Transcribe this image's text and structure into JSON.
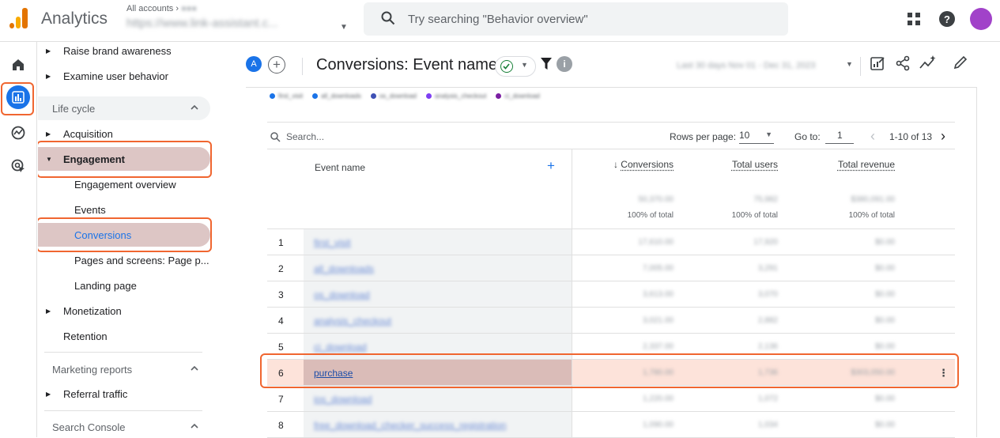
{
  "app": {
    "title": "Analytics"
  },
  "account": {
    "label": "All accounts",
    "name": "https://www.link-assistant.c..."
  },
  "search": {
    "placeholder": "Try searching \"Behavior overview\""
  },
  "nav": {
    "top_items": [
      "Raise brand awareness",
      "Examine user behavior"
    ],
    "lifecycle": {
      "label": "Life cycle",
      "acquisition": "Acquisition",
      "engagement": "Engagement",
      "engagement_children": [
        "Engagement overview",
        "Events",
        "Conversions",
        "Pages and screens: Page p...",
        "Landing page"
      ],
      "monetization": "Monetization",
      "retention": "Retention"
    },
    "marketing": {
      "label": "Marketing reports",
      "referral": "Referral traffic"
    },
    "search_console": {
      "label": "Search Console"
    }
  },
  "report": {
    "chip_letter": "A",
    "title": "Conversions: Event name",
    "info_glyph": "i",
    "date_range": "Last 30 days  Nov 01 - Dec 31, 2023"
  },
  "legend": [
    {
      "label": "first_visit",
      "color": "#1a73e8"
    },
    {
      "label": "all_downloads",
      "color": "#1a73e8"
    },
    {
      "label": "os_download",
      "color": "#3f51b5"
    },
    {
      "label": "analysis_checkout",
      "color": "#7e3ff2"
    },
    {
      "label": "ci_download",
      "color": "#7b1fa2"
    }
  ],
  "table": {
    "search_placeholder": "Search...",
    "rows_per_page_label": "Rows per page:",
    "rows_per_page": "10",
    "goto_label": "Go to:",
    "goto_value": "1",
    "page_info": "1-10 of 13",
    "columns": {
      "event_name": "Event name",
      "conversions": "Conversions",
      "total_users": "Total users",
      "total_revenue": "Total revenue"
    },
    "totals": {
      "conversions": "50,370.00",
      "users": "75,982",
      "revenue": "$380,091.00"
    },
    "pct_label": "100% of total",
    "rows": [
      {
        "idx": "1",
        "name": "first_visit",
        "conversions": "17,610.00",
        "users": "17,920",
        "revenue": "$0.00"
      },
      {
        "idx": "2",
        "name": "all_downloads",
        "conversions": "7,005.00",
        "users": "3,291",
        "revenue": "$0.00"
      },
      {
        "idx": "3",
        "name": "os_download",
        "conversions": "3,613.00",
        "users": "3,070",
        "revenue": "$0.00"
      },
      {
        "idx": "4",
        "name": "analysis_checkout",
        "conversions": "3,021.00",
        "users": "2,882",
        "revenue": "$0.00"
      },
      {
        "idx": "5",
        "name": "ci_download",
        "conversions": "2,337.00",
        "users": "2,136",
        "revenue": "$0.00"
      },
      {
        "idx": "6",
        "name": "purchase",
        "conversions": "1,780.00",
        "users": "1,736",
        "revenue": "$303,050.00"
      },
      {
        "idx": "7",
        "name": "ios_download",
        "conversions": "1,220.00",
        "users": "1,072",
        "revenue": "$0.00"
      },
      {
        "idx": "8",
        "name": "free_download_checker_success_registration",
        "conversions": "1,090.00",
        "users": "1,034",
        "revenue": "$0.00"
      }
    ]
  }
}
